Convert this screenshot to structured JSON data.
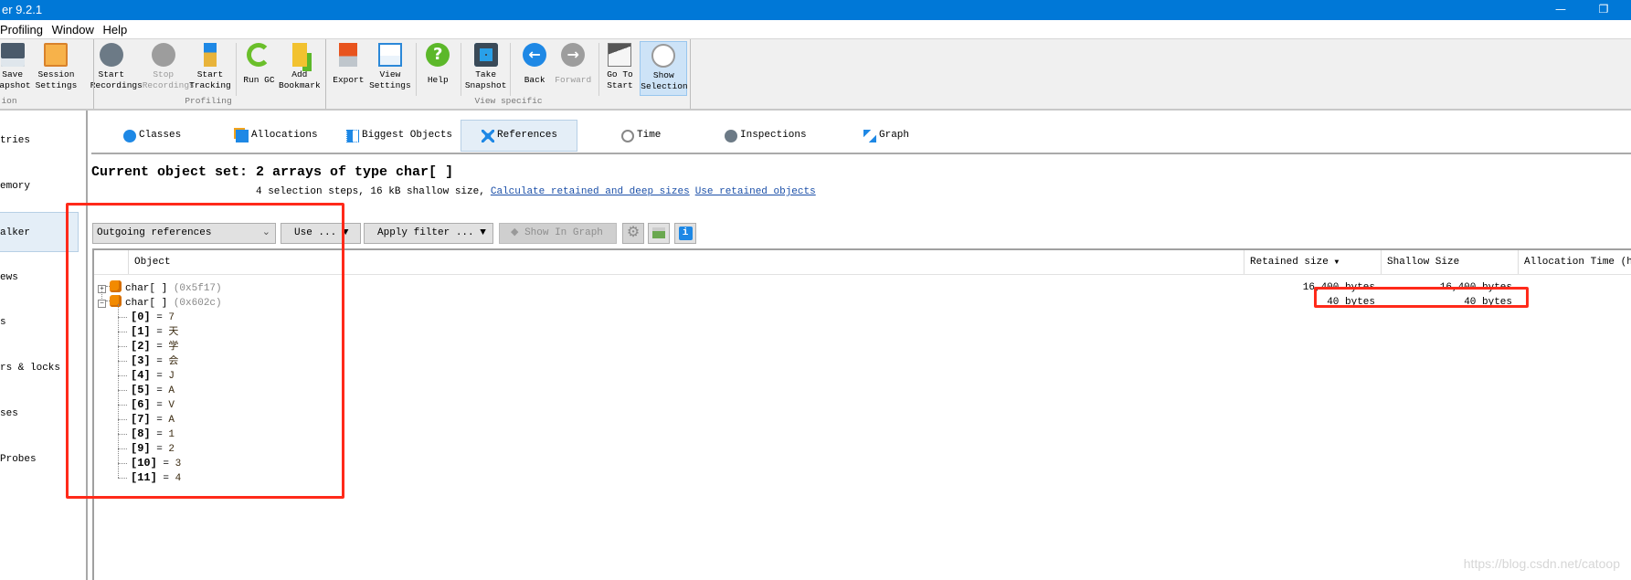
{
  "app": {
    "title": "er 9.2.1",
    "accent": "#0078d7"
  },
  "menu": [
    "Profiling",
    "Window",
    "Help"
  ],
  "toolbar": {
    "buttons": [
      {
        "l1": "Save",
        "l2": "napshot",
        "icon": "floppy-icon",
        "state": "normal"
      },
      {
        "l1": "Session",
        "l2": "Settings",
        "icon": "clipboard-icon",
        "state": "normal"
      },
      {
        "l1": "Start",
        "l2": "Recordings",
        "icon": "film-reel-play-icon",
        "state": "normal"
      },
      {
        "l1": "Stop",
        "l2": "Recordings",
        "icon": "film-reel-stop-icon",
        "state": "disabled"
      },
      {
        "l1": "Start",
        "l2": "Tracking",
        "icon": "signpost-icon",
        "state": "normal"
      },
      {
        "l1": "Run GC",
        "l2": "",
        "icon": "recycle-icon",
        "state": "normal"
      },
      {
        "l1": "Add",
        "l2": "Bookmark",
        "icon": "bookmark-add-icon",
        "state": "normal"
      },
      {
        "l1": "Export",
        "l2": "",
        "icon": "export-arrow-icon",
        "state": "normal"
      },
      {
        "l1": "View",
        "l2": "Settings",
        "icon": "window-check-icon",
        "state": "normal"
      },
      {
        "l1": "Help",
        "l2": "",
        "icon": "help-icon",
        "state": "normal"
      },
      {
        "l1": "Take",
        "l2": "Snapshot",
        "icon": "camera-icon",
        "state": "normal"
      },
      {
        "l1": "Back",
        "l2": "",
        "icon": "back-arrow-icon",
        "state": "normal"
      },
      {
        "l1": "Forward",
        "l2": "",
        "icon": "forward-arrow-icon",
        "state": "disabled"
      },
      {
        "l1": "Go To",
        "l2": "Start",
        "icon": "home-icon",
        "state": "normal"
      },
      {
        "l1": "Show",
        "l2": "Selection",
        "icon": "clock-selection-icon",
        "state": "selected"
      }
    ],
    "groups": [
      "ion",
      "Profiling",
      "View specific"
    ]
  },
  "sidebar": {
    "items": [
      "tries",
      "emory",
      "alker",
      "ews",
      "s",
      "rs & locks",
      "ses",
      "Probes"
    ],
    "selected": 2
  },
  "tabs": [
    {
      "label": "Classes",
      "icon": "class-c-icon"
    },
    {
      "label": "Allocations",
      "icon": "allocations-icon"
    },
    {
      "label": "Biggest Objects",
      "icon": "biggest-objects-icon"
    },
    {
      "label": "References",
      "icon": "references-icon",
      "selected": true
    },
    {
      "label": "Time",
      "icon": "clock-icon"
    },
    {
      "label": "Inspections",
      "icon": "gear-icon"
    },
    {
      "label": "Graph",
      "icon": "graph-icon"
    }
  ],
  "heading": "Current object set: 2 arrays of type char[ ]",
  "subline": {
    "text": "4 selection steps, 16 kB shallow size,",
    "link1": "Calculate retained and deep sizes",
    "link2": "Use retained objects"
  },
  "controls": {
    "reference_mode": "Outgoing references",
    "use": "Use ...",
    "apply_filter": "Apply filter ...",
    "show_in_graph": "Show In Graph"
  },
  "table": {
    "columns": [
      "Object",
      "Retained size",
      "Shallow Size",
      "Allocation Time (h:m"
    ],
    "sort_column": "Retained size",
    "rows": [
      {
        "name": "char[ ]",
        "id": "(0x5f17)",
        "retained": "16,400 bytes",
        "shallow": "16,400 bytes",
        "expanded": false
      },
      {
        "name": "char[ ]",
        "id": "(0x602c)",
        "retained": "40 bytes",
        "shallow": "40 bytes",
        "expanded": true,
        "children": [
          {
            "index": "[0]",
            "value": "7"
          },
          {
            "index": "[1]",
            "value": "天"
          },
          {
            "index": "[2]",
            "value": "学"
          },
          {
            "index": "[3]",
            "value": "会"
          },
          {
            "index": "[4]",
            "value": "J"
          },
          {
            "index": "[5]",
            "value": "A"
          },
          {
            "index": "[6]",
            "value": "V"
          },
          {
            "index": "[7]",
            "value": "A"
          },
          {
            "index": "[8]",
            "value": "1"
          },
          {
            "index": "[9]",
            "value": "2"
          },
          {
            "index": "[10]",
            "value": "3"
          },
          {
            "index": "[11]",
            "value": "4"
          }
        ]
      }
    ]
  },
  "annotation_color": "#ff2a1a",
  "watermark": "https://blog.csdn.net/catoop"
}
